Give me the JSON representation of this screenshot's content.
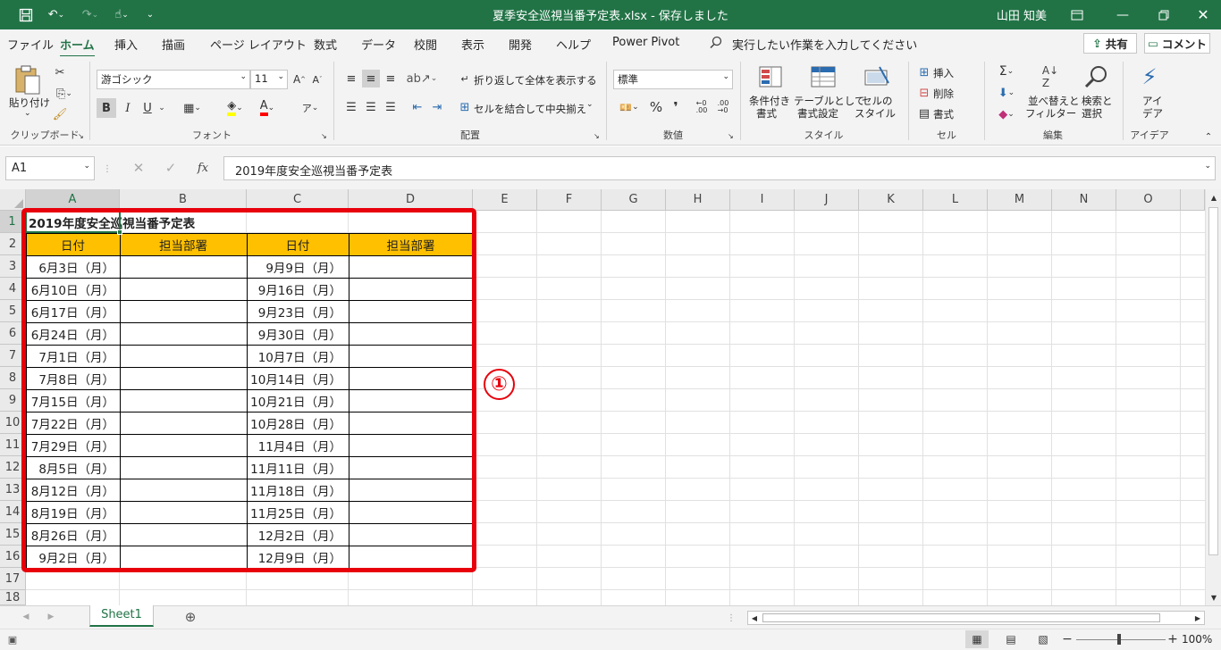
{
  "window": {
    "title": "夏季安全巡視当番予定表.xlsx  -  保存しました",
    "user": "山田 知美"
  },
  "menu": {
    "tabs": [
      "ファイル",
      "ホーム",
      "挿入",
      "描画",
      "ページ レイアウト",
      "数式",
      "データ",
      "校閲",
      "表示",
      "開発",
      "ヘルプ",
      "Power Pivot"
    ],
    "active_tab": "ホーム",
    "tell_me": "実行したい作業を入力してください",
    "share": "共有",
    "comment": "コメント"
  },
  "ribbon": {
    "clipboard": {
      "paste": "貼り付け",
      "label": "クリップボード"
    },
    "font": {
      "name": "游ゴシック",
      "size": "11",
      "label": "フォント",
      "bold": "B",
      "italic": "I",
      "underline": "U"
    },
    "alignment": {
      "wrap": "折り返して全体を表示する",
      "merge": "セルを結合して中央揃え",
      "label": "配置"
    },
    "number": {
      "format": "標準",
      "label": "数値"
    },
    "styles": {
      "cond_l1": "条件付き",
      "cond_l2": "書式",
      "table_l1": "テーブルとして",
      "table_l2": "書式設定",
      "cell_l1": "セルの",
      "cell_l2": "スタイル",
      "label": "スタイル"
    },
    "cells": {
      "insert": "挿入",
      "delete": "削除",
      "format": "書式",
      "label": "セル"
    },
    "editing": {
      "sort_l1": "並べ替えと",
      "sort_l2": "フィルター",
      "find_l1": "検索と",
      "find_l2": "選択",
      "label": "編集"
    },
    "ideas": {
      "l1": "アイ",
      "l2": "デア",
      "label": "アイデア"
    }
  },
  "formula_bar": {
    "name_box": "A1",
    "fx": "fx",
    "content": "2019年度安全巡視当番予定表"
  },
  "grid": {
    "columns": [
      "A",
      "B",
      "C",
      "D",
      "E",
      "F",
      "G",
      "H",
      "I",
      "J",
      "K",
      "L",
      "M",
      "N",
      "O"
    ],
    "rows": [
      "1",
      "2",
      "3",
      "4",
      "5",
      "6",
      "7",
      "8",
      "9",
      "10",
      "11",
      "12",
      "13",
      "14",
      "15",
      "16",
      "17",
      "18"
    ],
    "title": "2019年度安全巡視当番予定表",
    "headers": [
      "日付",
      "担当部署",
      "日付",
      "担当部署"
    ],
    "colA": [
      "6月3日（月）",
      "6月10日（月）",
      "6月17日（月）",
      "6月24日（月）",
      "7月1日（月）",
      "7月8日（月）",
      "7月15日（月）",
      "7月22日（月）",
      "7月29日（月）",
      "8月5日（月）",
      "8月12日（月）",
      "8月19日（月）",
      "8月26日（月）",
      "9月2日（月）"
    ],
    "colC": [
      "9月9日（月）",
      "9月16日（月）",
      "9月23日（月）",
      "9月30日（月）",
      "10月7日（月）",
      "10月14日（月）",
      "10月21日（月）",
      "10月28日（月）",
      "11月4日（月）",
      "11月11日（月）",
      "11月18日（月）",
      "11月25日（月）",
      "12月2日（月）",
      "12月9日（月）"
    ],
    "header_fill": "#ffc000",
    "highlight_color": "#e8000b",
    "annotation": "①"
  },
  "sheets": {
    "tabs": [
      "Sheet1"
    ],
    "active": "Sheet1"
  },
  "status": {
    "zoom": "100%"
  }
}
